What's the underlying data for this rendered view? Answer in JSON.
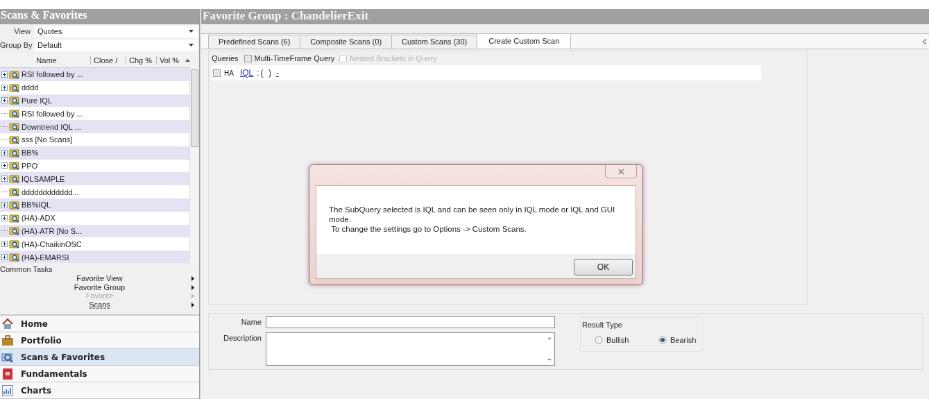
{
  "sidebar": {
    "title": "Scans & Favorites",
    "filters": [
      {
        "label": "View",
        "value": "Quotes"
      },
      {
        "label": "Group By",
        "value": "Default"
      }
    ],
    "tree": {
      "columns": [
        "Name",
        "Close /",
        "Chg %",
        "Vol %"
      ],
      "rows": [
        {
          "kind": "group",
          "label": "RSI followed by ..."
        },
        {
          "kind": "group",
          "label": "dddd"
        },
        {
          "kind": "group",
          "label": "Pure IQL"
        },
        {
          "kind": "scan",
          "label": "RSI followed by ..."
        },
        {
          "kind": "scan",
          "label": "Downtrend IQL ..."
        },
        {
          "kind": "scan",
          "label": "sss [No Scans]"
        },
        {
          "kind": "group",
          "label": "BB%"
        },
        {
          "kind": "group",
          "label": "PPO"
        },
        {
          "kind": "group",
          "label": "IQLSAMPLE"
        },
        {
          "kind": "scan",
          "label": "dddddddddddd..."
        },
        {
          "kind": "group",
          "label": "BB%IQL"
        },
        {
          "kind": "group",
          "label": "(HA)-ADX"
        },
        {
          "kind": "scan",
          "label": "(HA)-ATR [No S..."
        },
        {
          "kind": "group",
          "label": "(HA)-ChaikinOSC"
        },
        {
          "kind": "group",
          "label": "(HA)-EMARSI"
        }
      ]
    },
    "common_tasks": {
      "title": "Common Tasks",
      "items": [
        {
          "label": "Favorite View",
          "disabled": false
        },
        {
          "label": "Favorite Group",
          "disabled": false
        },
        {
          "label": "Favorite",
          "disabled": true
        },
        {
          "label": "Scans",
          "disabled": false
        }
      ]
    },
    "nav": [
      {
        "label": "Home",
        "selected": false
      },
      {
        "label": "Portfolio",
        "selected": false
      },
      {
        "label": "Scans & Favorites",
        "selected": true
      },
      {
        "label": "Fundamentals",
        "selected": false
      },
      {
        "label": "Charts",
        "selected": false
      }
    ]
  },
  "main": {
    "title": "Favorite Group : ChandelierExit",
    "tabs": [
      {
        "label": "Predefined Scans (6)",
        "selected": false
      },
      {
        "label": "Composite Scans (0)",
        "selected": false
      },
      {
        "label": "Custom Scans (30)",
        "selected": false
      },
      {
        "label": "Create Custom Scan",
        "selected": true
      }
    ],
    "queries": {
      "label": "Queries",
      "options": [
        {
          "label": "Multi-TimeFrame Query",
          "checked": false,
          "disabled": false
        },
        {
          "label": "Nested Brackets in Query",
          "checked": false,
          "disabled": true
        }
      ]
    },
    "query_line": {
      "ha": {
        "label": "HA",
        "checked": false
      },
      "link": "IQL",
      "tokens": ":( )",
      "trailing_link": "-"
    },
    "form": {
      "name_label": "Name",
      "description_label": "Description",
      "result_type": {
        "title": "Result Type",
        "options": [
          {
            "label": "Bullish",
            "selected": false
          },
          {
            "label": "Bearish",
            "selected": true
          }
        ]
      }
    }
  },
  "dialog": {
    "message": [
      "The SubQuery selected is IQL and can be seen only in IQL mode or IQL and GUI mode.",
      " To change the settings go to Options -> Custom Scans."
    ],
    "button": "OK"
  }
}
